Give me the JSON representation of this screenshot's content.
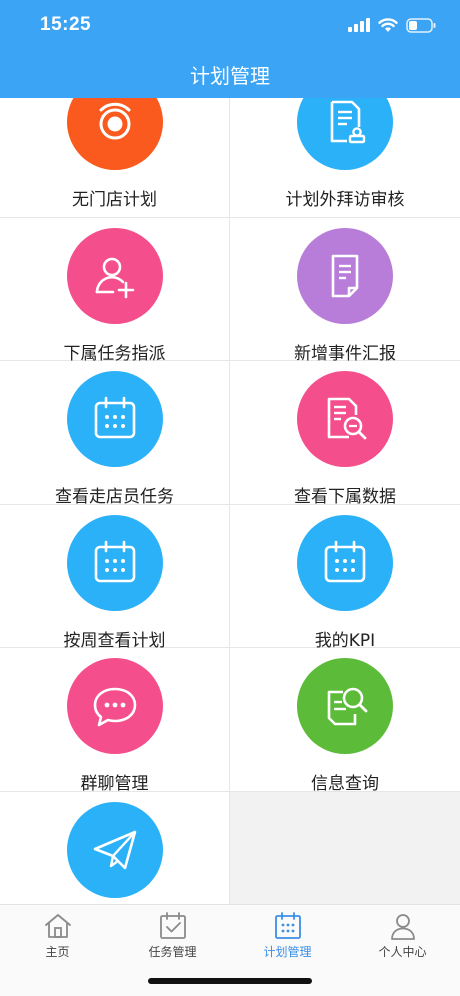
{
  "status_bar": {
    "time": "15:25"
  },
  "header": {
    "title": "计划管理"
  },
  "colors": {
    "header": "#3ba4f5",
    "orange": "#fa5a1e",
    "blue": "#2bb1f7",
    "pink": "#f44f8c",
    "purple": "#b87dd8",
    "green": "#5dbb3a",
    "active_tab": "#3b8ee6"
  },
  "menu": {
    "items": [
      {
        "label": "无门店计划",
        "icon": "target-icon",
        "color": "#fa5a1e"
      },
      {
        "label": "计划外拜访审核",
        "icon": "document-stamp-icon",
        "color": "#2bb1f7"
      },
      {
        "label": "下属任务指派",
        "icon": "add-user-icon",
        "color": "#f44f8c"
      },
      {
        "label": "新增事件汇报",
        "icon": "document-icon",
        "color": "#b87dd8"
      },
      {
        "label": "查看走店员任务",
        "icon": "calendar-icon",
        "color": "#2bb1f7"
      },
      {
        "label": "查看下属数据",
        "icon": "document-search-icon",
        "color": "#f44f8c"
      },
      {
        "label": "按周查看计划",
        "icon": "calendar-icon",
        "color": "#2bb1f7"
      },
      {
        "label": "我的KPI",
        "icon": "calendar-icon",
        "color": "#2bb1f7"
      },
      {
        "label": "群聊管理",
        "icon": "chat-bubble-icon",
        "color": "#f44f8c"
      },
      {
        "label": "信息查询",
        "icon": "info-search-icon",
        "color": "#5dbb3a"
      },
      {
        "label": "",
        "icon": "paper-plane-icon",
        "color": "#2bb1f7"
      }
    ]
  },
  "tabbar": {
    "tabs": [
      {
        "label": "主页",
        "icon": "home-icon",
        "active": false
      },
      {
        "label": "任务管理",
        "icon": "task-check-icon",
        "active": false
      },
      {
        "label": "计划管理",
        "icon": "calendar-icon",
        "active": true
      },
      {
        "label": "个人中心",
        "icon": "person-icon",
        "active": false
      }
    ]
  }
}
